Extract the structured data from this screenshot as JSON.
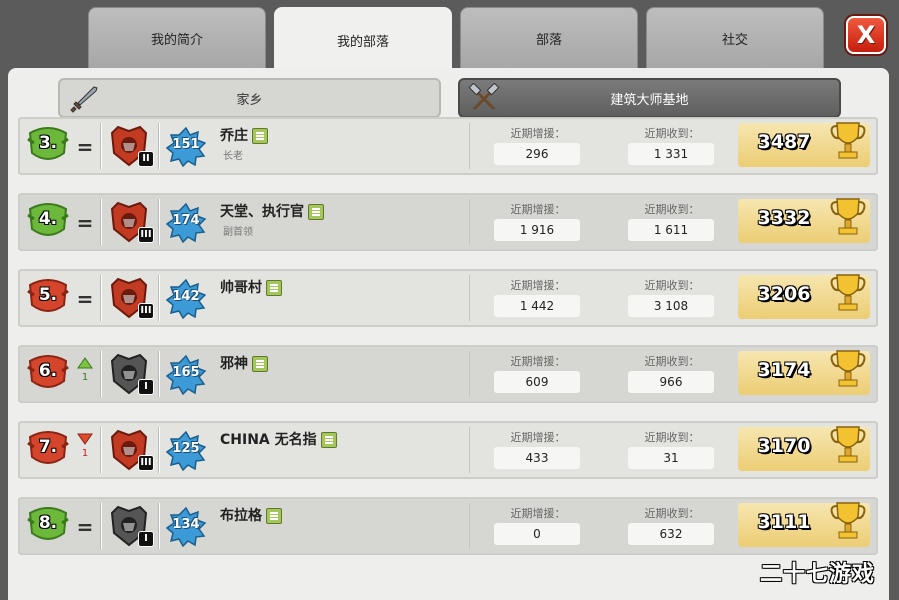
{
  "tabs": [
    {
      "label": "我的简介",
      "active": false
    },
    {
      "label": "我的部落",
      "active": true
    },
    {
      "label": "部落",
      "active": false
    },
    {
      "label": "社交",
      "active": false
    }
  ],
  "close_label": "X",
  "sub_tabs": {
    "home": {
      "label": "家乡",
      "icon": "sword-icon"
    },
    "builder": {
      "label": "建筑大师基地",
      "icon": "crossed-hammers-icon"
    }
  },
  "stat_labels": {
    "donated": "近期增援：",
    "received": "近期收到："
  },
  "members": [
    {
      "rank": "3.",
      "badge_color": "green",
      "change": "=",
      "change_num": "",
      "league_tier": "II",
      "league_color": "red",
      "level": "151",
      "name": "乔庄",
      "role": "长老",
      "donated": "296",
      "received": "1 331",
      "trophies": "3487"
    },
    {
      "rank": "4.",
      "badge_color": "green",
      "change": "=",
      "change_num": "",
      "league_tier": "III",
      "league_color": "red",
      "level": "174",
      "name": "天堂、执行官",
      "role": "副首领",
      "donated": "1 916",
      "received": "1 611",
      "trophies": "3332"
    },
    {
      "rank": "5.",
      "badge_color": "red",
      "change": "=",
      "change_num": "",
      "league_tier": "III",
      "league_color": "red",
      "level": "142",
      "name": "帅哥村",
      "role": "",
      "donated": "1 442",
      "received": "3 108",
      "trophies": "3206"
    },
    {
      "rank": "6.",
      "badge_color": "red",
      "change": "up",
      "change_num": "1",
      "league_tier": "I",
      "league_color": "grey",
      "level": "165",
      "name": "邪神",
      "role": "",
      "donated": "609",
      "received": "966",
      "trophies": "3174"
    },
    {
      "rank": "7.",
      "badge_color": "red",
      "change": "down",
      "change_num": "1",
      "league_tier": "III",
      "league_color": "red",
      "level": "125",
      "name": "CHINA 无名指",
      "role": "",
      "donated": "433",
      "received": "31",
      "trophies": "3170"
    },
    {
      "rank": "8.",
      "badge_color": "green",
      "change": "=",
      "change_num": "",
      "league_tier": "I",
      "league_color": "grey",
      "level": "134",
      "name": "布拉格",
      "role": "",
      "donated": "0",
      "received": "632",
      "trophies": "3111"
    }
  ],
  "watermark": "二十七游戏",
  "colors": {
    "accent_gold": "#eccd74",
    "close_red": "#d83a22",
    "xp_blue": "#3c9ad6"
  }
}
